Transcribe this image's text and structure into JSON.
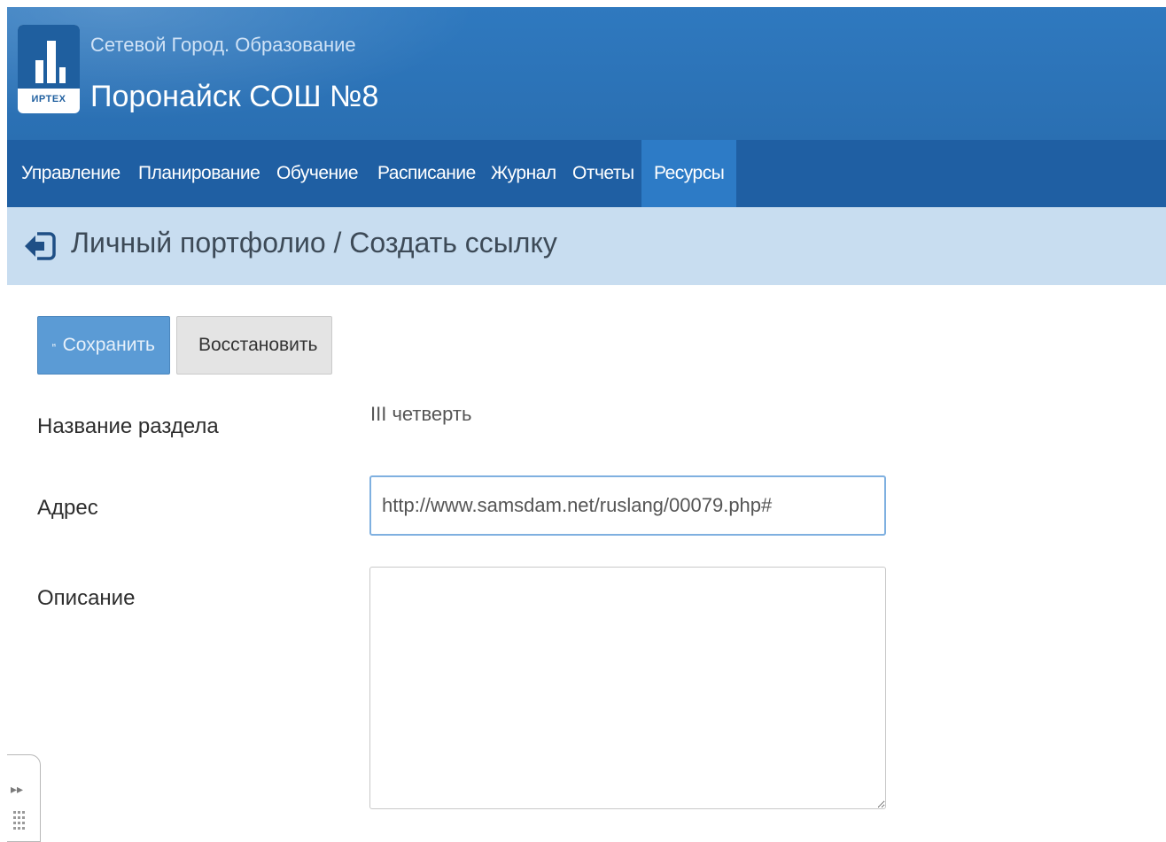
{
  "header": {
    "app_name": "Сетевой Город. Образование",
    "school_name": "Поронайск СОШ №8",
    "logo_text": "ИРТЕХ"
  },
  "nav": {
    "items": [
      {
        "label": "Управление"
      },
      {
        "label": "Планирование"
      },
      {
        "label": "Обучение"
      },
      {
        "label": "Расписание"
      },
      {
        "label": "Журнал"
      },
      {
        "label": "Отчеты"
      },
      {
        "label": "Ресурсы",
        "active": true
      }
    ]
  },
  "page": {
    "title": "Личный портфолио / Создать ссылку",
    "back_icon": "back-arrow-icon"
  },
  "toolbar": {
    "save_label": "Сохранить",
    "restore_label": "Восстановить"
  },
  "form": {
    "section_label": "Название раздела",
    "section_value": "III четверть",
    "address_label": "Адрес",
    "address_value": "http://www.samsdam.net/ruslang/00079.php#",
    "description_label": "Описание",
    "description_value": ""
  },
  "colors": {
    "header": "#2f79bf",
    "navbar": "#1f5fa3",
    "nav_active": "#2d7bc6",
    "titlebar": "#c8ddf0",
    "save_button": "#5b9bd5",
    "restore_button": "#e4e4e4"
  }
}
